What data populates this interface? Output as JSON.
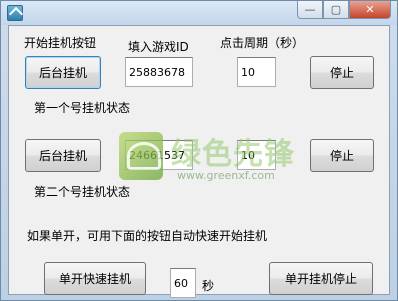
{
  "window": {
    "controls": {
      "minimize": "—",
      "maximize": "▢",
      "close": "✕"
    }
  },
  "header": {
    "col_start": "开始挂机按钮",
    "col_game_id": "填入游戏ID",
    "col_period": "点击周期（秒）"
  },
  "account1": {
    "start_label": "后台挂机",
    "game_id": "25883678",
    "period": "10",
    "stop_label": "停止",
    "status_text": "第一个号挂机状态"
  },
  "account2": {
    "start_label": "后台挂机",
    "game_id": "24661537",
    "period": "10",
    "stop_label": "停止",
    "status_text": "第二个号挂机状态"
  },
  "quick": {
    "hint": "如果单开，可用下面的按钮自动快速开始挂机",
    "start_label": "单开快速挂机",
    "seconds_value": "60",
    "seconds_unit": "秒",
    "stop_label": "单开挂机停止"
  },
  "watermark": {
    "text": "绿色先锋",
    "url": "www.greenxf.com"
  },
  "colors": {
    "title_gradient_top": "#dce8f5",
    "client_bg": "#f0f0f0",
    "close_button": "#c7432b"
  }
}
